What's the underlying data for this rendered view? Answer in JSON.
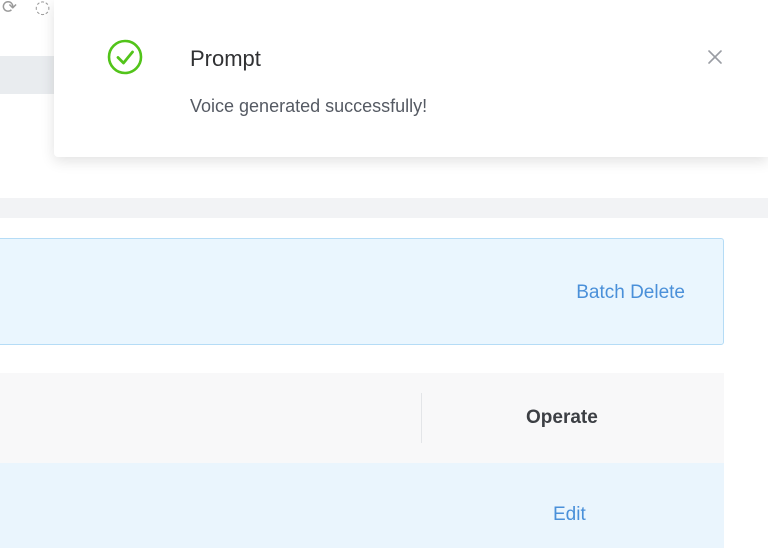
{
  "notification": {
    "title": "Prompt",
    "message": "Voice generated successfully!",
    "status_icon": "check-circle-icon",
    "close_icon": "close-icon",
    "accent_color": "#52c41a"
  },
  "toolbar": {
    "batch_delete_label": "Batch Delete"
  },
  "table": {
    "columns": [
      "Operate"
    ],
    "rows": [
      {
        "actions": [
          "Edit"
        ]
      }
    ]
  },
  "colors": {
    "link": "#4a90d9",
    "info_panel_bg": "#eaf6fe",
    "info_panel_border": "#b5dcf6",
    "row_highlight": "#eaf5fd",
    "header_bg": "#f8f8f9"
  }
}
